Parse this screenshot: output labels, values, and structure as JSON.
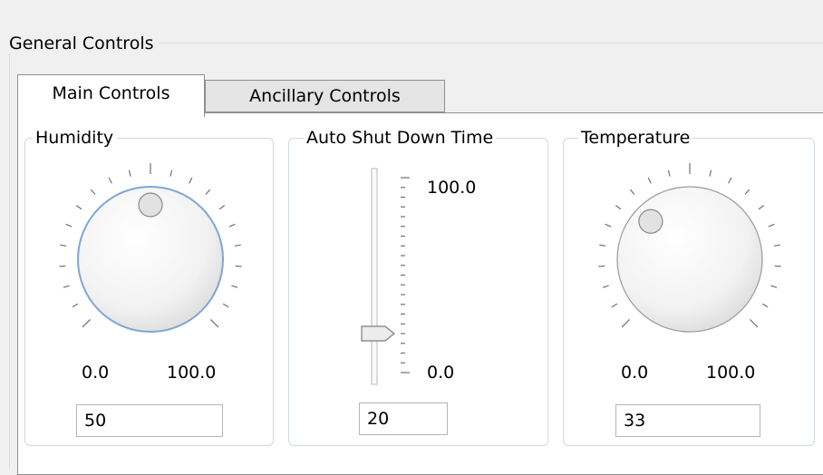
{
  "group": {
    "title": "General Controls"
  },
  "tabs": [
    {
      "label": "Main Controls",
      "active": true
    },
    {
      "label": "Ancillary Controls",
      "active": false
    }
  ],
  "humidity": {
    "title": "Humidity",
    "min_label": "0.0",
    "max_label": "100.0",
    "value": "50",
    "knob_value": 50
  },
  "shutdown": {
    "title": "Auto Shut Down Time",
    "max_label": "100.0",
    "min_label": "0.0",
    "value": "20",
    "slider_value": 20
  },
  "temperature": {
    "title": "Temperature",
    "min_label": "0.0",
    "max_label": "100.0",
    "value": "33",
    "knob_value": 33
  },
  "colors": {
    "focus_ring": "#7ea6d4",
    "tick": "#707070"
  }
}
